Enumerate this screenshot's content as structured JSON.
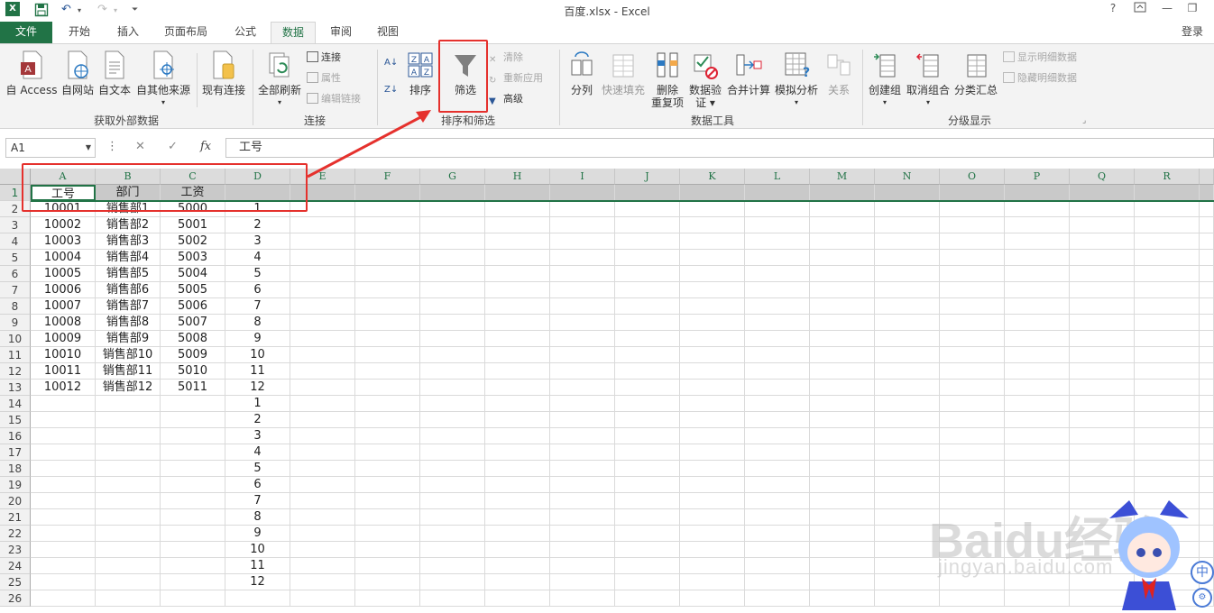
{
  "titlebar": {
    "title": "百度.xlsx - Excel",
    "help": "?",
    "minimize": "—",
    "restore": "❐"
  },
  "tabs": {
    "file": "文件",
    "home": "开始",
    "insert": "插入",
    "layout": "页面布局",
    "formulas": "公式",
    "data": "数据",
    "review": "审阅",
    "view": "视图",
    "login": "登录"
  },
  "ribbon": {
    "get_external": {
      "access": "自 Access",
      "web": "自网站",
      "text": "自文本",
      "other": "自其他来源",
      "existing": "现有连接",
      "label": "获取外部数据"
    },
    "connections": {
      "refresh_all": "全部刷新",
      "connections": "连接",
      "properties": "属性",
      "edit_links": "编辑链接",
      "label": "连接"
    },
    "sort_filter": {
      "sort": "排序",
      "filter": "筛选",
      "clear": "清除",
      "reapply": "重新应用",
      "advanced": "高级",
      "label": "排序和筛选"
    },
    "data_tools": {
      "text_to_columns": "分列",
      "flash_fill": "快速填充",
      "remove_dup_1": "删除",
      "remove_dup_2": "重复项",
      "validation_1": "数据验",
      "validation_2": "证 ▾",
      "consolidate": "合并计算",
      "what_if": "模拟分析",
      "relationships": "关系",
      "label": "数据工具"
    },
    "outline": {
      "group": "创建组",
      "ungroup": "取消组合",
      "subtotal": "分类汇总",
      "show_detail": "显示明细数据",
      "hide_detail": "隐藏明细数据",
      "label": "分级显示"
    }
  },
  "formula_bar": {
    "name_box": "A1",
    "cancel": "✕",
    "enter": "✓",
    "fx": "fx",
    "value": "工号"
  },
  "sheet": {
    "columns": [
      "A",
      "B",
      "C",
      "D",
      "E",
      "F",
      "G",
      "H",
      "I",
      "J",
      "K",
      "L",
      "M",
      "N",
      "O",
      "P",
      "Q",
      "R"
    ],
    "rows": [
      [
        "工号",
        "部门",
        "工资",
        ""
      ],
      [
        "10001",
        "销售部1",
        "5000",
        "1"
      ],
      [
        "10002",
        "销售部2",
        "5001",
        "2"
      ],
      [
        "10003",
        "销售部3",
        "5002",
        "3"
      ],
      [
        "10004",
        "销售部4",
        "5003",
        "4"
      ],
      [
        "10005",
        "销售部5",
        "5004",
        "5"
      ],
      [
        "10006",
        "销售部6",
        "5005",
        "6"
      ],
      [
        "10007",
        "销售部7",
        "5006",
        "7"
      ],
      [
        "10008",
        "销售部8",
        "5007",
        "8"
      ],
      [
        "10009",
        "销售部9",
        "5008",
        "9"
      ],
      [
        "10010",
        "销售部10",
        "5009",
        "10"
      ],
      [
        "10011",
        "销售部11",
        "5010",
        "11"
      ],
      [
        "10012",
        "销售部12",
        "5011",
        "12"
      ],
      [
        "",
        "",
        "",
        "1"
      ],
      [
        "",
        "",
        "",
        "2"
      ],
      [
        "",
        "",
        "",
        "3"
      ],
      [
        "",
        "",
        "",
        "4"
      ],
      [
        "",
        "",
        "",
        "5"
      ],
      [
        "",
        "",
        "",
        "6"
      ],
      [
        "",
        "",
        "",
        "7"
      ],
      [
        "",
        "",
        "",
        "8"
      ],
      [
        "",
        "",
        "",
        "9"
      ],
      [
        "",
        "",
        "",
        "10"
      ],
      [
        "",
        "",
        "",
        "11"
      ],
      [
        "",
        "",
        "",
        "12"
      ],
      [
        "",
        "",
        "",
        ""
      ]
    ]
  },
  "watermark": {
    "brand": "Baidu经验",
    "url": "jingyan.baidu.com",
    "badge": "中"
  },
  "colors": {
    "excel_green": "#217346",
    "annotation_red": "#e5312d"
  }
}
